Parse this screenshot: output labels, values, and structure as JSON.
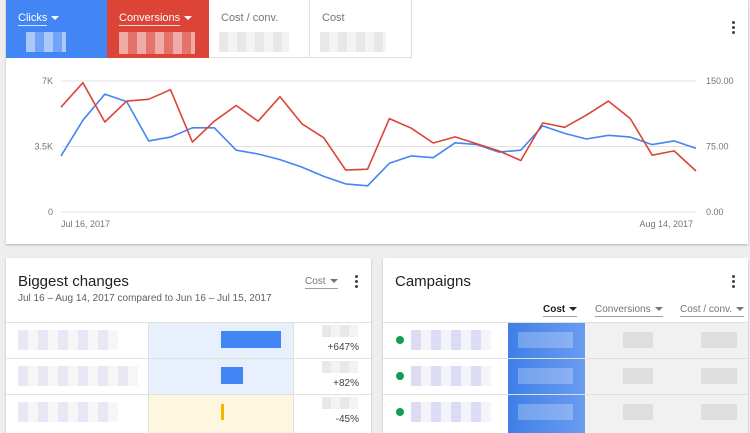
{
  "metric_tabs": [
    {
      "label": "Clicks",
      "active": true,
      "color": "#4285f4"
    },
    {
      "label": "Conversions",
      "active": true,
      "color": "#db4437"
    },
    {
      "label": "Cost / conv.",
      "active": false
    },
    {
      "label": "Cost",
      "active": false
    }
  ],
  "chart_data": {
    "type": "line",
    "x_start_label": "Jul 16, 2017",
    "x_end_label": "Aug 14, 2017",
    "left_ticks": [
      "7K",
      "3.5K",
      "0"
    ],
    "right_ticks": [
      "150.00",
      "75.00",
      "0.00"
    ],
    "ylim_left": [
      0,
      7000
    ],
    "ylim_right": [
      0,
      150
    ],
    "x": [
      1,
      2,
      3,
      4,
      5,
      6,
      7,
      8,
      9,
      10,
      11,
      12,
      13,
      14,
      15,
      16,
      17,
      18,
      19,
      20,
      21,
      22,
      23,
      24,
      25,
      26,
      27,
      28,
      29,
      30
    ],
    "series": [
      {
        "color": "#4285f4",
        "axis": "left",
        "values": [
          3000,
          4900,
          6300,
          5900,
          3800,
          4000,
          4500,
          4500,
          3300,
          3100,
          2800,
          2400,
          1900,
          1500,
          1400,
          2600,
          3000,
          2900,
          3700,
          3600,
          3200,
          3300,
          4600,
          4200,
          3900,
          4100,
          4000,
          3600,
          3800,
          3400
        ]
      },
      {
        "color": "#db4437",
        "axis": "right",
        "values": [
          120,
          148,
          103,
          127,
          129,
          140,
          80,
          104,
          122,
          104,
          132,
          101,
          85,
          48,
          49,
          107,
          96,
          79,
          86,
          78,
          70,
          59,
          102,
          97,
          111,
          127,
          107,
          65,
          70,
          47
        ]
      }
    ]
  },
  "changes": {
    "title": "Biggest changes",
    "subtitle": "Jul 16 – Aug 14, 2017 compared to Jun 16 – Jul 15, 2017",
    "metric": "Cost",
    "rows": [
      {
        "change": "+647%",
        "bar_fraction": 0.8,
        "positive": true
      },
      {
        "change": "+82%",
        "bar_fraction": 0.29,
        "positive": true
      },
      {
        "change": "-45%",
        "bar_fraction": 0.04,
        "positive": false
      }
    ]
  },
  "campaigns": {
    "title": "Campaigns",
    "columns": [
      "Cost",
      "Conversions",
      "Cost / conv."
    ],
    "rows": [
      {
        "status": "enabled"
      },
      {
        "status": "enabled"
      },
      {
        "status": "enabled"
      }
    ]
  },
  "colors": {
    "positive_bar": "#4285f4",
    "negative_bar": "#f4b400",
    "status_dot": "#0f9d58"
  }
}
